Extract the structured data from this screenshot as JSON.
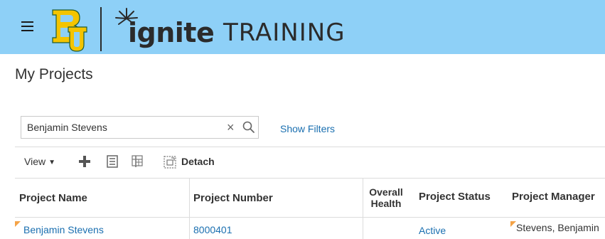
{
  "header": {
    "logo_text": "BU",
    "brand": "ignite",
    "brand_suffix": "TRAINING",
    "colors": {
      "banner": "#8ed0f7",
      "logo_gold": "#f4c400",
      "logo_green": "#1f5c36"
    }
  },
  "page": {
    "title": "My Projects"
  },
  "search": {
    "value": "Benjamin Stevens",
    "show_filters_label": "Show Filters"
  },
  "toolbar": {
    "view_label": "View",
    "icons": [
      "add-icon",
      "list-icon",
      "freeze-icon",
      "detach-icon"
    ],
    "detach_label": "Detach"
  },
  "table": {
    "columns": {
      "name": "Project Name",
      "number": "Project Number",
      "health_line1": "Overall",
      "health_line2": "Health",
      "status": "Project Status",
      "manager": "Project Manager"
    },
    "rows": [
      {
        "name": "Benjamin Stevens",
        "number": "8000401",
        "health": "",
        "status": "Active",
        "manager": "Stevens, Benjamin"
      }
    ]
  },
  "colors": {
    "link": "#1a6fb0",
    "flag": "#f4a347",
    "text": "#333333"
  }
}
